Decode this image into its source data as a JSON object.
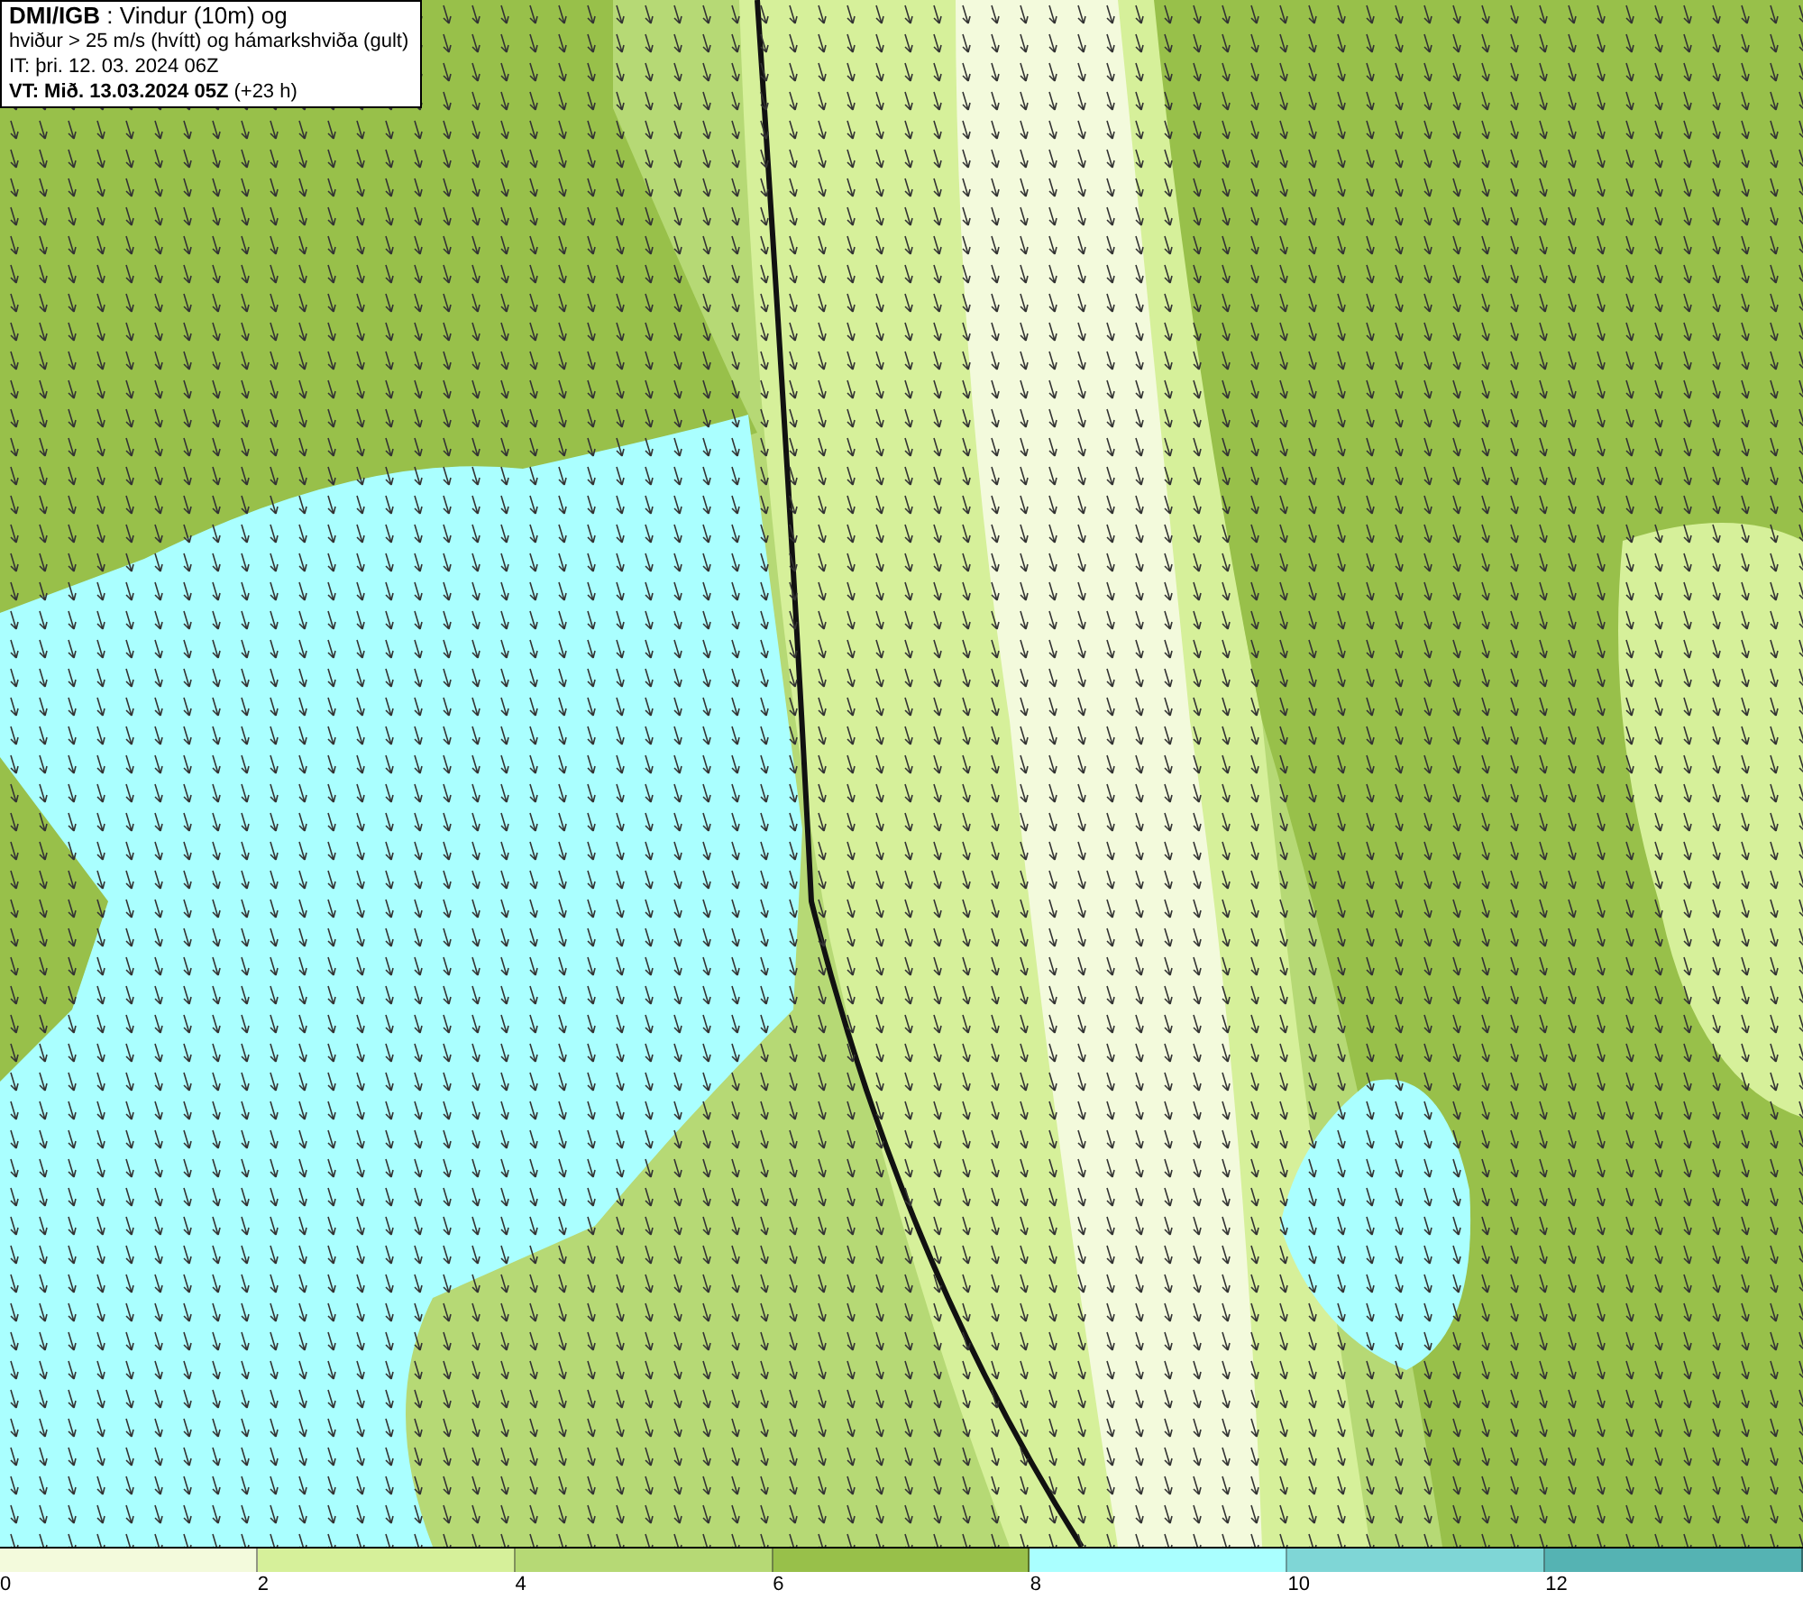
{
  "title_box": {
    "lines": [
      "**DMI/IGB** : Vindur (10m) og",
      "hviður > 25 m/s (hvítt) og hámarkshviða (gult)",
      "IT: þri. 12. 03. 2024 06Z",
      "**VT: Mið. 13.03.2024 05Z** (+23 h)"
    ]
  },
  "legend": {
    "bins": [
      {
        "color": "#f3fadc"
      },
      {
        "color": "#d6f09a"
      },
      {
        "color": "#b6d975"
      },
      {
        "color": "#98c04a"
      },
      {
        "color": "#aaffff"
      },
      {
        "color": "#7fd6d6"
      },
      {
        "color": "#55b3b3"
      }
    ],
    "ticks": [
      "0",
      "2",
      "4",
      "6",
      "8",
      "10",
      "12"
    ]
  }
}
